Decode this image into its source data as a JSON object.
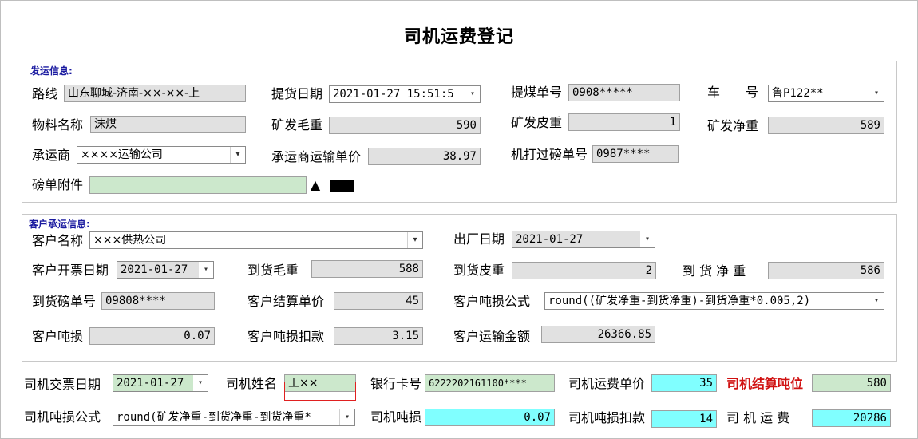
{
  "title": "司机运费登记",
  "dispatch": {
    "group_title": "发运信息:",
    "route_label": "路线",
    "route_value": "山东聊城-济南-××-××-上",
    "pickup_date_label": "提货日期",
    "pickup_date_value": "2021-01-27 15:51:5",
    "coal_bill_label": "提煤单号",
    "coal_bill_value": "0908*****",
    "vehicle_label": "车　　号",
    "vehicle_value": "鲁P122**",
    "material_label": "物料名称",
    "material_value": "沫煤",
    "gross_label": "矿发毛重",
    "gross_value": "590",
    "tare_label": "矿发皮重",
    "tare_value": "1",
    "net_label": "矿发净重",
    "net_value": "589",
    "carrier_label": "承运商",
    "carrier_value": "××××运输公司",
    "carrier_price_label": "承运商运输单价",
    "carrier_price_value": "38.97",
    "weigh_no_label": "机打过磅单号",
    "weigh_no_value": "0987****",
    "attachment_label": "磅单附件",
    "attachment_value": "",
    "upload_glyph": "▲"
  },
  "customer": {
    "group_title": "客户承运信息:",
    "name_label": "客户名称",
    "name_value": "×××供热公司",
    "factory_date_label": "出厂日期",
    "factory_date_value": "2021-01-27",
    "invoice_date_label": "客户开票日期",
    "invoice_date_value": "2021-01-27",
    "arrive_gross_label": "到货毛重",
    "arrive_gross_value": "588",
    "arrive_tare_label": "到货皮重",
    "arrive_tare_value": "2",
    "arrive_net_label": "到 货 净 重",
    "arrive_net_value": "586",
    "arrive_weigh_label": "到货磅单号",
    "arrive_weigh_value": "09808****",
    "settle_price_label": "客户结算单价",
    "settle_price_value": "45",
    "loss_formula_label": "客户吨损公式",
    "loss_formula_value": "round((矿发净重-到货净重)-到货净重*0.005,2)",
    "loss_label": "客户吨损",
    "loss_value": "0.07",
    "loss_deduct_label": "客户吨损扣款",
    "loss_deduct_value": "3.15",
    "transport_amount_label": "客户运输金额",
    "transport_amount_value": "26366.85"
  },
  "driver": {
    "invoice_date_label": "司机交票日期",
    "invoice_date_value": "2021-01-27",
    "name_label": "司机姓名",
    "name_value": "王××",
    "bank_label": "银行卡号",
    "bank_value": "6222202161100****",
    "freight_price_label": "司机运费单价",
    "freight_price_value": "35",
    "settle_ton_label": "司机结算吨位",
    "settle_ton_value": "580",
    "loss_formula_label": "司机吨损公式",
    "loss_formula_value": "round(矿发净重-到货净重-到货净重*",
    "loss_label": "司机吨损",
    "loss_value": "0.07",
    "loss_deduct_label": "司机吨损扣款",
    "loss_deduct_value": "14",
    "freight_label": "司 机 运 费",
    "freight_value": "20286"
  },
  "icons": {
    "dropdown": "chevron-down-icon",
    "upload": "upload-triangle-icon"
  },
  "colors": {
    "readonly": "#e1e1e1",
    "green_field": "#cce8cc",
    "cyan_field": "#80ffff",
    "accent_red": "#d01010",
    "group_title": "#1a1aa0"
  }
}
